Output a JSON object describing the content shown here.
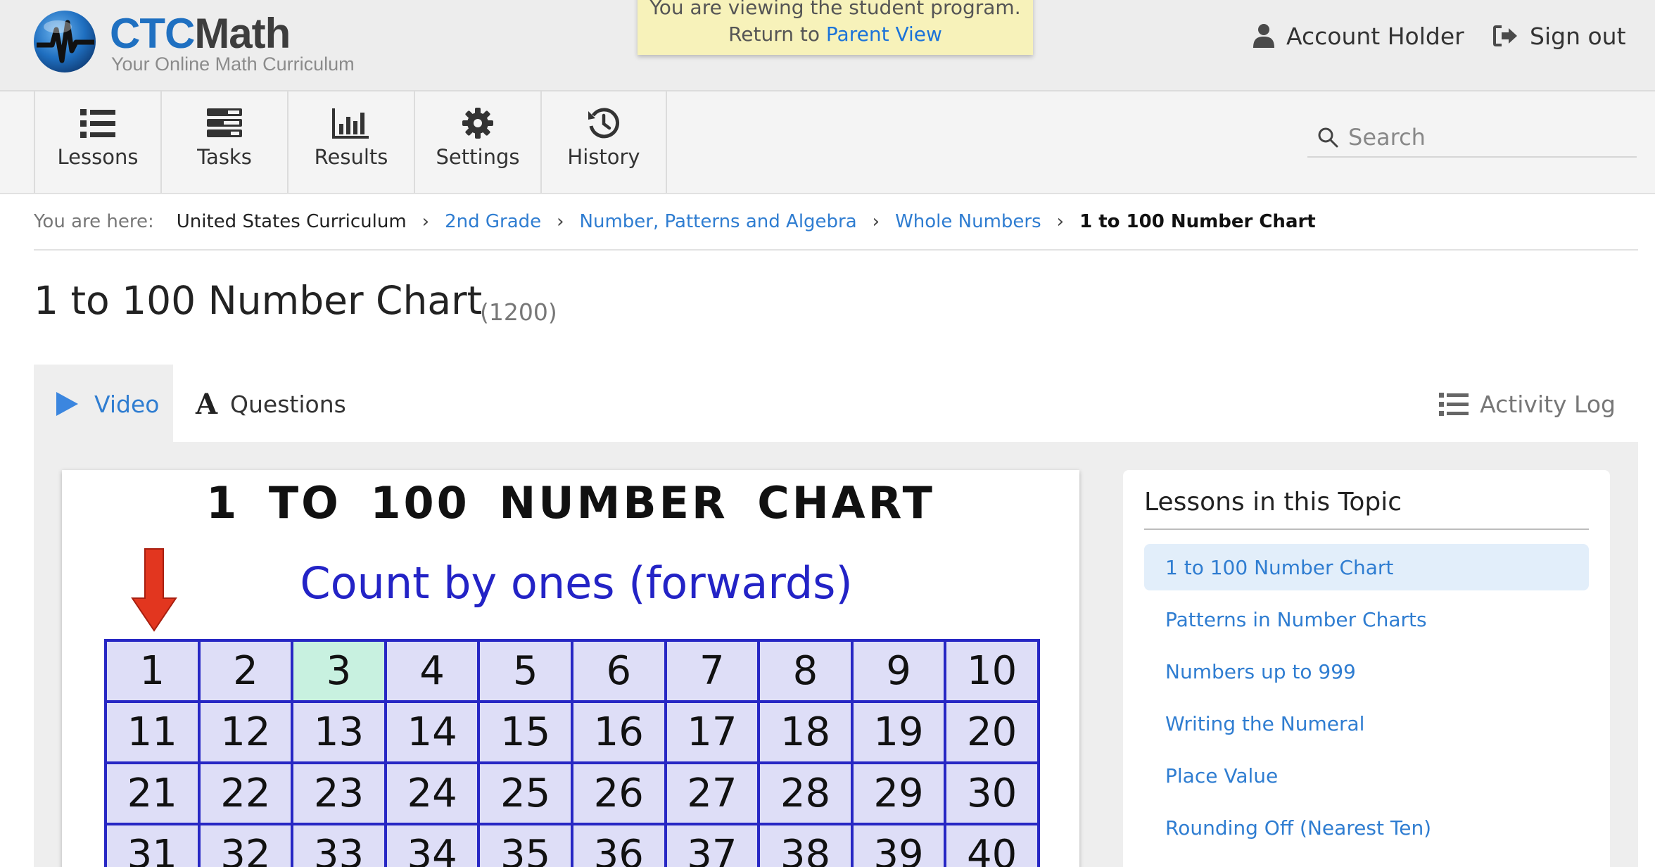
{
  "header": {
    "logo_brand_prefix": "CTC",
    "logo_brand_suffix": "Math",
    "logo_tagline": "Your Online Math Curriculum",
    "notice_line1": "You are viewing the student program.",
    "notice_line2_prefix": "Return to",
    "notice_link": "Parent View",
    "account_label": "Account Holder",
    "signout_label": "Sign out"
  },
  "nav": {
    "items": [
      {
        "label": "Lessons",
        "icon": "list-icon"
      },
      {
        "label": "Tasks",
        "icon": "tasks-icon"
      },
      {
        "label": "Results",
        "icon": "bar-chart-icon"
      },
      {
        "label": "Settings",
        "icon": "gear-icon"
      },
      {
        "label": "History",
        "icon": "history-icon"
      }
    ],
    "search_placeholder": "Search"
  },
  "breadcrumb": {
    "prefix": "You are here:",
    "items": [
      "United States Curriculum",
      "2nd Grade",
      "Number, Patterns and Algebra",
      "Whole Numbers",
      "1 to 100 Number Chart"
    ]
  },
  "page": {
    "title": "1 to 100 Number Chart",
    "code": "(1200)"
  },
  "tabs": {
    "video": "Video",
    "questions": "Questions",
    "activity_log": "Activity Log"
  },
  "video": {
    "title": "1 TO 100 NUMBER CHART",
    "subtitle": "Count by ones  (forwards)",
    "grid_rows": [
      [
        "1",
        "2",
        "3",
        "4",
        "5",
        "6",
        "7",
        "8",
        "9",
        "10"
      ],
      [
        "11",
        "12",
        "13",
        "14",
        "15",
        "16",
        "17",
        "18",
        "19",
        "20"
      ],
      [
        "21",
        "22",
        "23",
        "24",
        "25",
        "26",
        "27",
        "28",
        "29",
        "30"
      ],
      [
        "31",
        "32",
        "33",
        "34",
        "35",
        "36",
        "37",
        "38",
        "39",
        "40"
      ]
    ],
    "highlighted_cell": "3"
  },
  "lessons_panel": {
    "heading": "Lessons in this Topic",
    "items": [
      "1 to 100 Number Chart",
      "Patterns in Number Charts",
      "Numbers up to 999",
      "Writing the Numeral",
      "Place Value",
      "Rounding Off (Nearest Ten)"
    ],
    "active_index": 0
  },
  "colors": {
    "link_blue": "#2f7dd1",
    "brand_blue": "#1f70c1",
    "notice_bg": "#f7f2ba",
    "grid_border": "#2727c4",
    "grid_fill": "#dedef7",
    "grid_highlight": "#c8f1e0",
    "arrow_red": "#e2361f"
  }
}
